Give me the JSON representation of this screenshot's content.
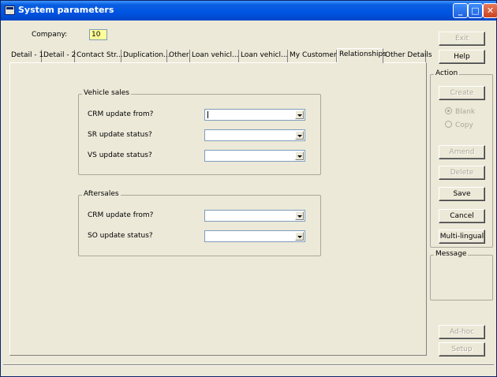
{
  "window": {
    "title": "System parameters"
  },
  "company": {
    "label": "Company:",
    "value": "10"
  },
  "tabs": [
    {
      "label": "Detail - 1"
    },
    {
      "label": "Detail - 2"
    },
    {
      "label": "Contact Str..."
    },
    {
      "label": "Duplication..."
    },
    {
      "label": "Other"
    },
    {
      "label": "Loan vehicl..."
    },
    {
      "label": "Loan vehicl..."
    },
    {
      "label": "My Customers"
    },
    {
      "label": "Relationships"
    },
    {
      "label": "Other Details"
    }
  ],
  "active_tab": "Relationships",
  "vehicle_sales": {
    "title": "Vehicle sales",
    "fields": [
      {
        "label": "CRM update from?",
        "value": ""
      },
      {
        "label": "SR update status?",
        "value": ""
      },
      {
        "label": "VS update status?",
        "value": ""
      }
    ]
  },
  "aftersales": {
    "title": "Aftersales",
    "fields": [
      {
        "label": "CRM update from?",
        "value": ""
      },
      {
        "label": "SO update status?",
        "value": ""
      }
    ]
  },
  "buttons": {
    "exit": "Exit",
    "help": "Help",
    "create": "Create",
    "amend": "Amend",
    "delete": "Delete",
    "save": "Save",
    "cancel": "Cancel",
    "multilingual": "Multi-lingual",
    "adhoc": "Ad-hoc",
    "setup": "Setup"
  },
  "action": {
    "title": "Action",
    "radio_blank": "Blank",
    "radio_copy": "Copy"
  },
  "message": {
    "title": "Message"
  }
}
